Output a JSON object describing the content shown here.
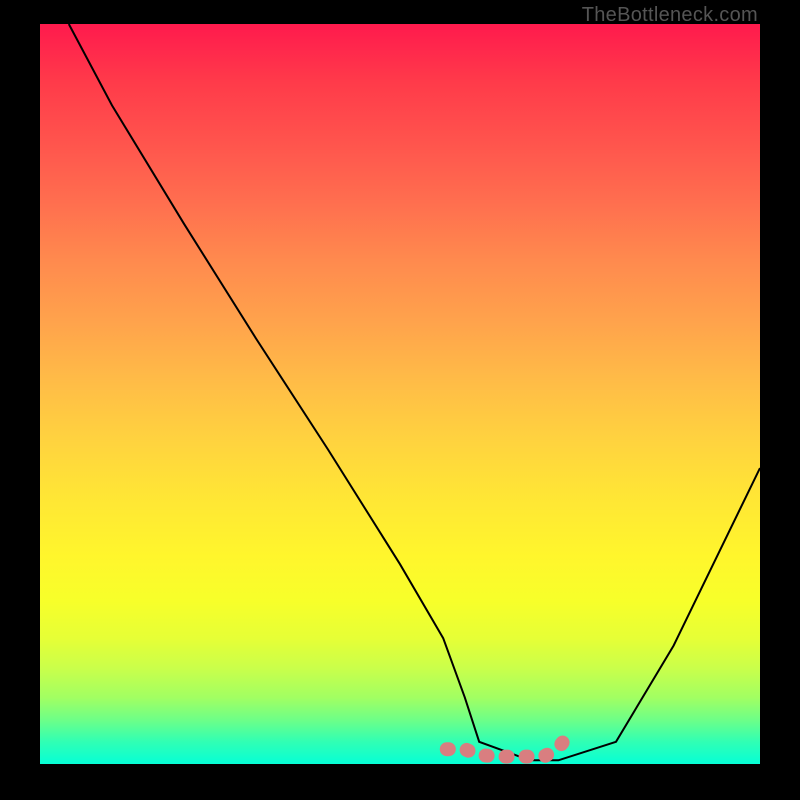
{
  "watermark": "TheBottleneck.com",
  "chart_data": {
    "type": "line",
    "title": "",
    "xlabel": "",
    "ylabel": "",
    "xlim": [
      0,
      100
    ],
    "ylim": [
      0,
      100
    ],
    "series": [
      {
        "name": "curve",
        "x": [
          4,
          10,
          20,
          30,
          40,
          50,
          56,
          59,
          61,
          68,
          72,
          80,
          88,
          96,
          100
        ],
        "values": [
          100,
          89,
          73,
          57.5,
          42.5,
          27,
          17,
          9,
          3,
          0.5,
          0.5,
          3,
          16,
          32,
          40
        ]
      }
    ],
    "highlight_band": {
      "x_points": [
        56.5,
        59,
        61,
        64,
        67,
        70,
        72,
        73.5
      ],
      "y_points": [
        2,
        2,
        1.2,
        1.0,
        1.0,
        1.0,
        2.2,
        4
      ]
    },
    "highlight_style": {
      "stroke": "#d97e80",
      "stroke_width_px": 14,
      "dasharray": "2 18"
    },
    "line_style": {
      "stroke": "#000000",
      "stroke_width_px": 2
    }
  }
}
